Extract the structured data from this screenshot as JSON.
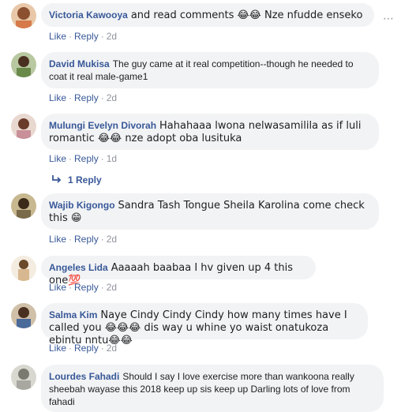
{
  "comments": [
    {
      "author": "Victoria Kawooya",
      "text": "and read comments 😂😂 Nze nfudde enseko",
      "like": "Like",
      "reply": "Reply",
      "time": "2d",
      "avatar_color": "#d67a4a"
    },
    {
      "author": "David Mukisa",
      "text": "The guy came at it real competition--though he needed to coat it real male-game1",
      "like": "Like",
      "reply": "Reply",
      "time": "2d",
      "avatar_color": "#6a8a4a"
    },
    {
      "author": "Mulungi Evelyn Divorah",
      "text": "Hahahaaa lwona nelwasamilila as if luli romantic 😂😂 nze adopt oba lusituka",
      "like": "Like",
      "reply": "Reply",
      "time": "1d",
      "avatar_color": "#c89098"
    },
    {
      "author": "Wajib Kigongo",
      "text": "Sandra Tash Tongue Sheila Karolina come check this 😁",
      "like": "Like",
      "reply": "Reply",
      "time": "2d",
      "avatar_color": "#7a6a4a"
    },
    {
      "author": "Angeles Lida",
      "text": "Aaaaah baabaa I hv given up 4 this one💯",
      "like": "Like",
      "reply": "Reply",
      "time": "2d",
      "avatar_color": "#d8b890"
    },
    {
      "author": "Salma Kim",
      "text": "Naye Cindy Cindy Cindy how many times have I called you 😂😂😂 dis way u whine yo waist onatukoza ebintu nntu😂😂",
      "like": "Like",
      "reply": "Reply",
      "time": "2d",
      "avatar_color": "#4a6a9a"
    },
    {
      "author": "Lourdes Fahadi",
      "text": "Should I say I love exercise more than wankoona really sheebah wayase this 2018 keep up sis keep up Darling lots of love from fahadi",
      "avatar_color": "#a8a8a0"
    }
  ],
  "replies_label": "1 Reply",
  "more_icon": "⋯"
}
